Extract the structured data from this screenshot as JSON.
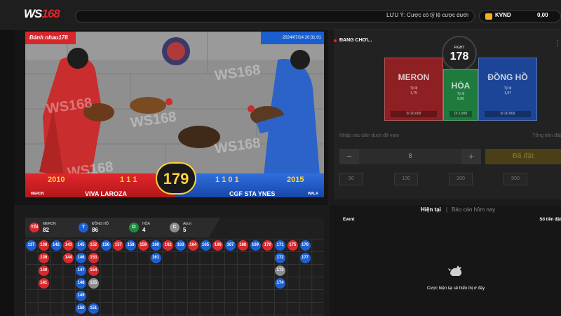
{
  "header": {
    "logo_prefix": "WS",
    "logo_suffix": "168",
    "notice": "LƯU Ý: Cược có tỷ lệ cược dưới",
    "currency": "KVND",
    "balance": "0,00"
  },
  "video": {
    "fight_name": "Đánh nhau178",
    "timestamp": "2024/07/14 20:31:01",
    "watermark": "WS168",
    "left_score": "2010",
    "left_record": "1 1 1",
    "left_side": "MERON",
    "left_name": "VIVA LAROZA",
    "right_score": "2015",
    "right_record": "1 1 0 1",
    "right_side": "WALA",
    "right_name": "CGF STA YNES",
    "round": "179"
  },
  "bet": {
    "live_label": "ĐANG CHƠI...",
    "fight_label": "FIGHT",
    "fight_number": "178",
    "cards": [
      {
        "name": "MERON",
        "odds_label": "Tỷ lệ",
        "odds": "1,75",
        "total": "0/ 20.000"
      },
      {
        "name": "HÒA",
        "odds_label": "Tỷ lệ",
        "odds": "8,00",
        "total": "0/ 2.000"
      },
      {
        "name": "ĐỒNG HỒ",
        "odds_label": "Tỷ lệ",
        "odds": "1,97",
        "total": "0/ 20.000"
      }
    ],
    "vote_hint": "Nhấp vào bên dưới để vote",
    "total_hint": "Tổng tiền đặt",
    "stake": "8",
    "minus": "−",
    "plus": "+",
    "place_label": "Đã đặt",
    "chips": [
      "50",
      "100",
      "200",
      "500"
    ]
  },
  "history": {
    "tab_current": "Hiện tại",
    "tab_separator": "|",
    "tab_today": "Báo cáo hôm nay",
    "col_event": "Event",
    "col_amount": "Số tiền đặt",
    "empty_text": "Cược hiện tại sẽ hiển thị ở đây"
  },
  "road": {
    "stats": [
      {
        "letter": "Tôi",
        "label": "MERON",
        "count": "82",
        "color": "#d82a2e"
      },
      {
        "letter": "T",
        "label": "ĐỒNG HỒ",
        "count": "86",
        "color": "#1d5fd0"
      },
      {
        "letter": "D",
        "label": "HÒA",
        "count": "4",
        "color": "#1f8a3e"
      },
      {
        "letter": "C",
        "label": "Abort",
        "count": "5",
        "color": "#8c8c8c"
      }
    ],
    "columns": [
      [
        {
          "n": "137",
          "c": "blue"
        }
      ],
      [
        {
          "n": "138",
          "c": "red"
        },
        {
          "n": "139",
          "c": "red"
        },
        {
          "n": "140",
          "c": "red"
        },
        {
          "n": "141",
          "c": "red"
        }
      ],
      [
        {
          "n": "142",
          "c": "blue"
        }
      ],
      [
        {
          "n": "143",
          "c": "red"
        },
        {
          "n": "144",
          "c": "red"
        }
      ],
      [
        {
          "n": "145",
          "c": "blue"
        },
        {
          "n": "146",
          "c": "blue"
        },
        {
          "n": "147",
          "c": "blue"
        },
        {
          "n": "148",
          "c": "blue"
        },
        {
          "n": "149",
          "c": "blue"
        },
        {
          "n": "150",
          "c": "blue"
        }
      ],
      [
        {
          "n": "152",
          "c": "red"
        },
        {
          "n": "153",
          "c": "red"
        },
        {
          "n": "154",
          "c": "red"
        },
        {
          "n": "155",
          "c": "grey"
        },
        null,
        {
          "n": "151",
          "c": "blue"
        }
      ],
      [
        {
          "n": "156",
          "c": "blue"
        }
      ],
      [
        {
          "n": "157",
          "c": "red"
        }
      ],
      [
        {
          "n": "158",
          "c": "blue"
        }
      ],
      [
        {
          "n": "159",
          "c": "red"
        }
      ],
      [
        {
          "n": "160",
          "c": "blue"
        },
        {
          "n": "161",
          "c": "blue"
        }
      ],
      [
        {
          "n": "162",
          "c": "red"
        }
      ],
      [
        {
          "n": "163",
          "c": "blue"
        }
      ],
      [
        {
          "n": "164",
          "c": "red"
        }
      ],
      [
        {
          "n": "165",
          "c": "blue"
        }
      ],
      [
        {
          "n": "166",
          "c": "red"
        }
      ],
      [
        {
          "n": "167",
          "c": "blue"
        }
      ],
      [
        {
          "n": "168",
          "c": "red"
        }
      ],
      [
        {
          "n": "169",
          "c": "blue"
        }
      ],
      [
        {
          "n": "170",
          "c": "red"
        }
      ],
      [
        {
          "n": "171",
          "c": "blue"
        },
        {
          "n": "172",
          "c": "blue"
        },
        {
          "n": "173",
          "c": "grey"
        },
        {
          "n": "174",
          "c": "blue"
        }
      ],
      [
        {
          "n": "175",
          "c": "red"
        }
      ],
      [
        {
          "n": "176",
          "c": "blue"
        },
        {
          "n": "177",
          "c": "blue"
        }
      ]
    ]
  }
}
